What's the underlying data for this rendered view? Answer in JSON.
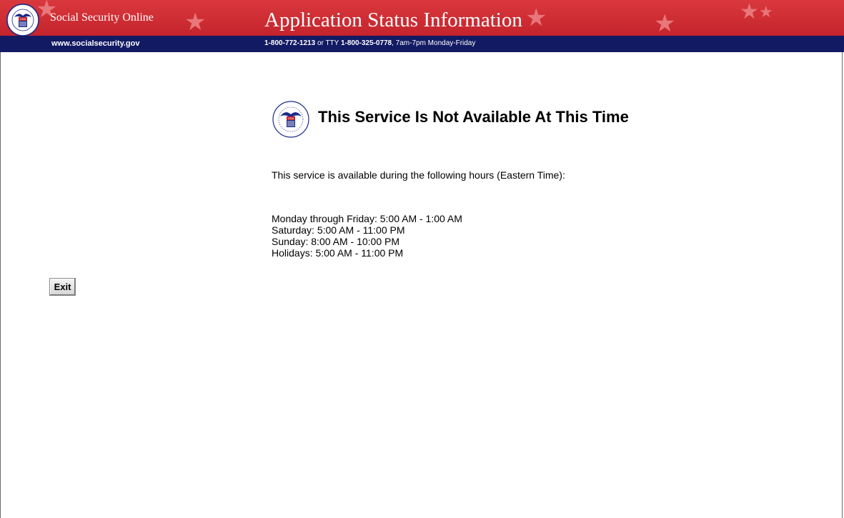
{
  "header": {
    "site_name": "Social Security Online",
    "app_title": "Application Status Information",
    "site_url": "www.socialsecurity.gov",
    "phone_primary": "1-800-772-1213",
    "phone_or_tty": " or TTY ",
    "phone_tty": "1-800-325-0778",
    "phone_hours": ", 7am-7pm Monday-Friday",
    "seal_text": "USA"
  },
  "notice": {
    "title": "This Service Is Not Available At This Time",
    "intro": "This service is available during the following hours (Eastern Time):",
    "hours": [
      "Monday through Friday: 5:00 AM - 1:00 AM",
      "Saturday: 5:00 AM - 11:00 PM",
      "Sunday: 8:00 AM - 10:00 PM",
      "Holidays: 5:00 AM - 11:00 PM"
    ]
  },
  "actions": {
    "exit_label": "Exit"
  },
  "colors": {
    "header_red": "#c4242c",
    "header_navy": "#121a63",
    "star": "#e8767a",
    "seal_blue": "#1c2a8a"
  },
  "icons": {
    "seal": "ssa-seal-icon",
    "star": "star-icon"
  }
}
